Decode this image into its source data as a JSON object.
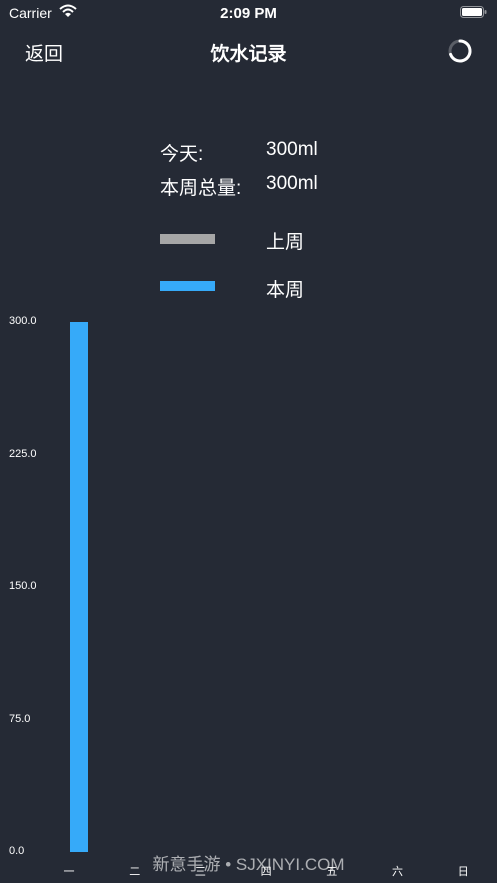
{
  "status_bar": {
    "carrier": "Carrier",
    "time": "2:09 PM"
  },
  "nav": {
    "back_label": "返回",
    "title": "饮水记录"
  },
  "summary": {
    "today_label": "今天:",
    "today_value": "300ml",
    "week_label": "本周总量:",
    "week_value": "300ml"
  },
  "legend": [
    {
      "label": "上周",
      "color": "#a6a6a6"
    },
    {
      "label": "本周",
      "color": "#36aaf9"
    }
  ],
  "chart_data": {
    "type": "bar",
    "categories": [
      "一",
      "二",
      "三",
      "四",
      "五",
      "六",
      "日"
    ],
    "series": [
      {
        "name": "上周",
        "color": "#a6a6a6",
        "values": [
          0,
          0,
          0,
          0,
          0,
          0,
          0
        ]
      },
      {
        "name": "本周",
        "color": "#36aaf9",
        "values": [
          300,
          0,
          0,
          0,
          0,
          0,
          0
        ]
      }
    ],
    "yticks": [
      "0.0",
      "75.0",
      "150.0",
      "225.0",
      "300.0"
    ],
    "ylim": [
      0,
      300
    ],
    "title": "",
    "xlabel": "",
    "ylabel": "",
    "grid": false,
    "legend_placement": "top"
  },
  "watermark": "新意手游 • SJXINYI.COM"
}
